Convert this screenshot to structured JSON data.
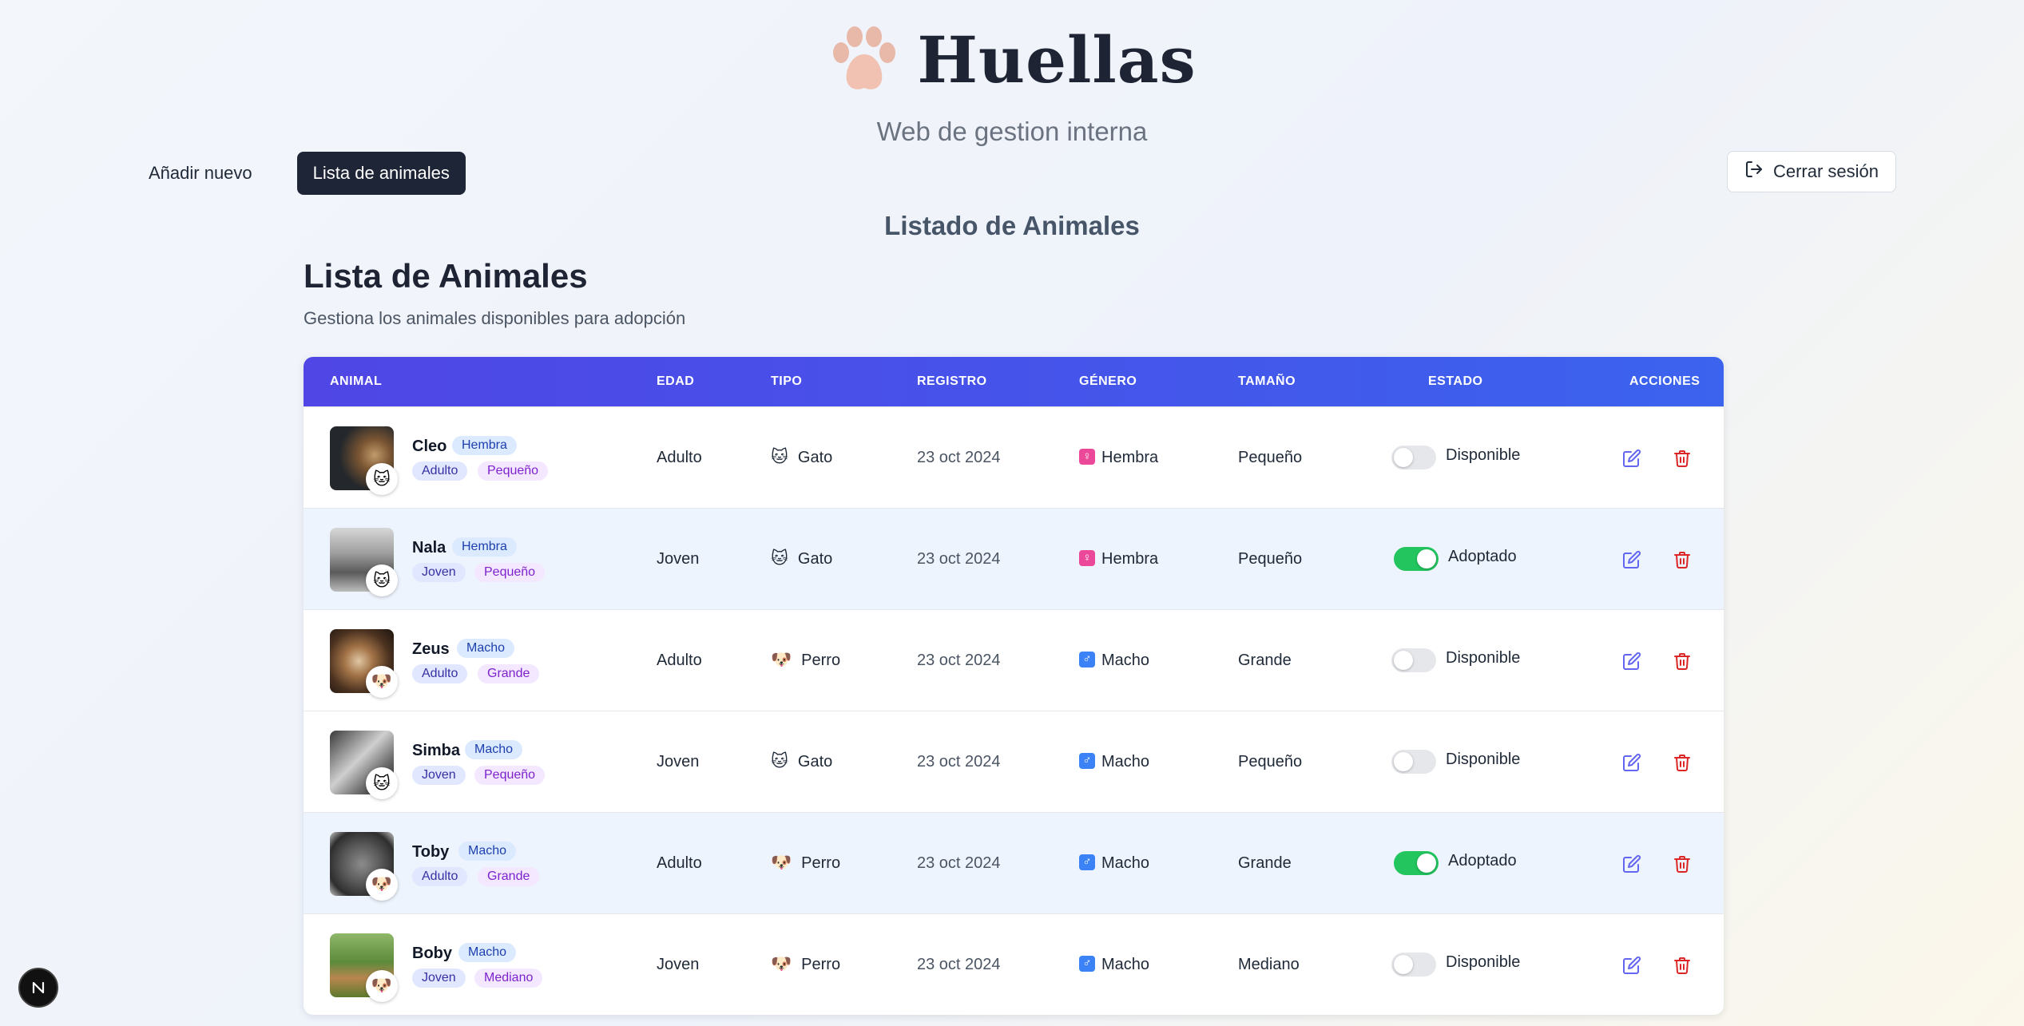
{
  "brand": {
    "title": "Huellas",
    "subtitle": "Web de gestion interna"
  },
  "nav": {
    "add_new": "Añadir nuevo",
    "animal_list": "Lista de animales"
  },
  "logout": {
    "label": "Cerrar sesión"
  },
  "page": {
    "section_title": "Listado de Animales",
    "list_title": "Lista de Animales",
    "list_description": "Gestiona los animales disponibles para adopción"
  },
  "table": {
    "headers": {
      "animal": "ANIMAL",
      "age": "EDAD",
      "type": "TIPO",
      "registered": "REGISTRO",
      "gender": "GÉNERO",
      "size": "TAMAÑO",
      "status": "ESTADO",
      "actions": "ACCIONES"
    },
    "rows": [
      {
        "name": "Cleo",
        "gender": "Hembra",
        "age": "Adulto",
        "size": "Pequeño",
        "type": "Gato",
        "type_icon": "🐱",
        "registered": "23 oct 2024",
        "gender_symbol": "♀",
        "status": "Disponible",
        "adopted": false
      },
      {
        "name": "Nala",
        "gender": "Hembra",
        "age": "Joven",
        "size": "Pequeño",
        "type": "Gato",
        "type_icon": "🐱",
        "registered": "23 oct 2024",
        "gender_symbol": "♀",
        "status": "Adoptado",
        "adopted": true
      },
      {
        "name": "Zeus",
        "gender": "Macho",
        "age": "Adulto",
        "size": "Grande",
        "type": "Perro",
        "type_icon": "🐶",
        "registered": "23 oct 2024",
        "gender_symbol": "♂",
        "status": "Disponible",
        "adopted": false
      },
      {
        "name": "Simba",
        "gender": "Macho",
        "age": "Joven",
        "size": "Pequeño",
        "type": "Gato",
        "type_icon": "🐱",
        "registered": "23 oct 2024",
        "gender_symbol": "♂",
        "status": "Disponible",
        "adopted": false
      },
      {
        "name": "Toby",
        "gender": "Macho",
        "age": "Adulto",
        "size": "Grande",
        "type": "Perro",
        "type_icon": "🐶",
        "registered": "23 oct 2024",
        "gender_symbol": "♂",
        "status": "Adoptado",
        "adopted": true
      },
      {
        "name": "Boby",
        "gender": "Macho",
        "age": "Joven",
        "size": "Mediano",
        "type": "Perro",
        "type_icon": "🐶",
        "registered": "23 oct 2024",
        "gender_symbol": "♂",
        "status": "Disponible",
        "adopted": false
      }
    ]
  },
  "icons": {
    "logo": "paw-icon",
    "logout": "logout-icon",
    "edit": "edit-icon",
    "delete": "trash-icon",
    "floating": "n-logo-icon"
  },
  "colors": {
    "header_gradient_start": "#4f46e5",
    "header_gradient_end": "#3b63ee",
    "available_toggle": "#e5e7eb",
    "adopted_toggle": "#22c55e",
    "edit": "#6366f1",
    "delete": "#dc2626",
    "nav_active": "#1e2536"
  }
}
